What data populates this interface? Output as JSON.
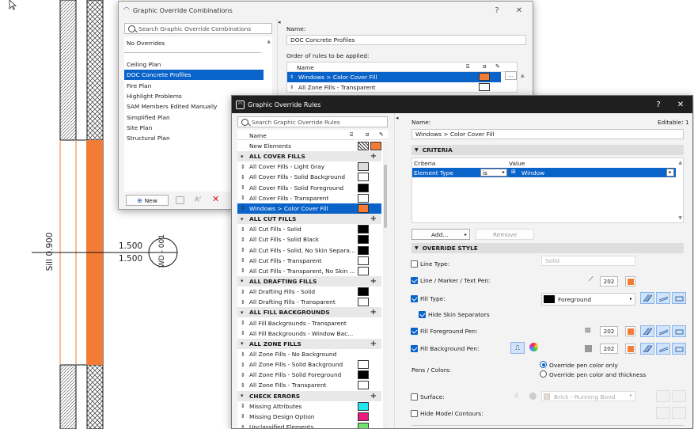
{
  "drawing": {
    "sill_label": "Sill 0.900",
    "dim_top": "1.500",
    "dim_bottom": "1.500",
    "marker_label": "WD - 001"
  },
  "combo": {
    "title": "Graphic Override Combinations",
    "help": "?",
    "close": "✕",
    "search_placeholder": "Search Graphic Override Combinations",
    "top_item": "No Overrides",
    "items": [
      "Ceiling Plan",
      "DOC Concrete Profiles",
      "Fire Plan",
      "Highlight Problems",
      "SAM Members Edited Manually",
      "Simplified Plan",
      "Site Plan",
      "Structural Plan"
    ],
    "selected_index": 1,
    "name_label": "Name:",
    "name_value": "DOC Concrete Profiles",
    "order_label": "Order of rules to be applied:",
    "col_name": "Name",
    "rules": [
      {
        "name": "Windows > Color Cover Fill",
        "color": "#f27b35",
        "selected": true
      },
      {
        "name": "All Zone Fills - Transparent",
        "color": "#ffffff",
        "selected": false
      }
    ],
    "new_button": "New",
    "more_button": "..."
  },
  "rules": {
    "title": "Graphic Override Rules",
    "help": "?",
    "close": "✕",
    "search_placeholder": "Search Graphic Override Rules",
    "col_name": "Name",
    "list": [
      {
        "type": "item",
        "name": "New Elements",
        "sw": "hatch"
      },
      {
        "type": "header",
        "name": "ALL COVER FILLS"
      },
      {
        "type": "item",
        "name": "All Cover Fills - Light Gray",
        "sw": "#dcdcdc"
      },
      {
        "type": "item",
        "name": "All Cover Fills - Solid Background",
        "sw": "#ffffff"
      },
      {
        "type": "item",
        "name": "All Cover Fills - Solid Foreground",
        "sw": "#000000"
      },
      {
        "type": "item",
        "name": "All Cover Fills - Transparent",
        "sw": "#ffffff"
      },
      {
        "type": "item",
        "name": "Windows > Color Cover Fill",
        "sw": "#f27b35",
        "selected": true
      },
      {
        "type": "header",
        "name": "ALL CUT FILLS"
      },
      {
        "type": "item",
        "name": "All Cut Fills - Solid",
        "sw": "#000000"
      },
      {
        "type": "item",
        "name": "All Cut Fills - Solid Black",
        "sw": "#000000"
      },
      {
        "type": "item",
        "name": "All Cut Fills - Solid, No Skin Separa...",
        "sw": "#000000"
      },
      {
        "type": "item",
        "name": "All Cut Fills - Transparent",
        "sw": "#ffffff"
      },
      {
        "type": "item",
        "name": "All Cut Fills - Transparent, No Skin ...",
        "sw": "#ffffff"
      },
      {
        "type": "header",
        "name": "ALL DRAFTING FILLS"
      },
      {
        "type": "item",
        "name": "All Drafting Fills - Solid",
        "sw": "#000000"
      },
      {
        "type": "item",
        "name": "All Drafting Fills - Transparent",
        "sw": "#ffffff"
      },
      {
        "type": "header",
        "name": "ALL FILL BACKGROUNDS"
      },
      {
        "type": "item",
        "name": "All Fill Backgrounds - Transparent",
        "sw": ""
      },
      {
        "type": "item",
        "name": "All Fill Backgrounds - Window Bac...",
        "sw": ""
      },
      {
        "type": "header",
        "name": "ALL ZONE FILLS"
      },
      {
        "type": "item",
        "name": "All Zone Fills - No Background",
        "sw": ""
      },
      {
        "type": "item",
        "name": "All Zone Fills - Solid Background",
        "sw": "#ffffff"
      },
      {
        "type": "item",
        "name": "All Zone Fills - Solid Foreground",
        "sw": "#000000"
      },
      {
        "type": "item",
        "name": "All Zone Fills - Transparent",
        "sw": "#ffffff"
      },
      {
        "type": "header",
        "name": "CHECK ERRORS"
      },
      {
        "type": "item",
        "name": "Missing Attributes",
        "sw": "#22e6f0"
      },
      {
        "type": "item",
        "name": "Missing Design Option",
        "sw": "#ea1b7d"
      },
      {
        "type": "item",
        "name": "Unclassified Elements",
        "sw": "#6fe36f"
      }
    ],
    "name_label": "Name:",
    "editable_label": "Editable: 1",
    "name_value": "Windows > Color Cover Fill",
    "criteria_header": "CRITERIA",
    "criteria_col": "Criteria",
    "value_col": "Value",
    "criteria_row": {
      "criteria": "Element Type",
      "op": "is",
      "value": "Window"
    },
    "add_button": "Add...",
    "remove_button": "Remove",
    "style_header": "OVERRIDE STYLE",
    "line_type_label": "Line Type:",
    "line_type_value": "Solid",
    "line_pen_label": "Line / Marker / Text Pen:",
    "line_pen_value": "202",
    "fill_type_label": "Fill Type:",
    "fill_type_value": "Foreground",
    "skin_sep_label": "Hide Skin Separators",
    "fg_pen_label": "Fill Foreground Pen:",
    "fg_pen_value": "202",
    "bg_pen_label": "Fill Background Pen:",
    "bg_pen_value": "202",
    "pens_colors_label": "Pens / Colors:",
    "radio1": "Override pen color only",
    "radio2": "Override pen color and thickness",
    "surface_label": "Surface:",
    "surface_value": "Brick - Running Bond",
    "hide_contours_label": "Hide Model Contours:"
  }
}
